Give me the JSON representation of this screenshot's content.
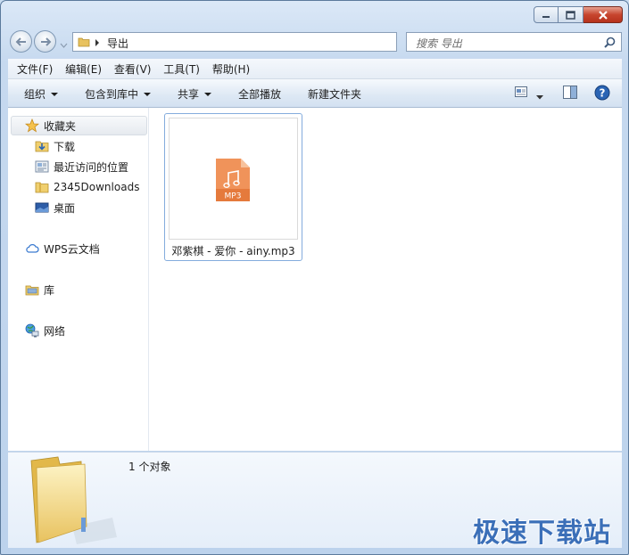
{
  "window": {
    "controls": {
      "minimize": "minimize",
      "maximize": "maximize",
      "close": "close"
    }
  },
  "navbar": {
    "address_path": "导出",
    "search_placeholder": "搜索 导出"
  },
  "menu": {
    "items": [
      "文件(F)",
      "编辑(E)",
      "查看(V)",
      "工具(T)",
      "帮助(H)"
    ]
  },
  "toolbar": {
    "organize": "组织",
    "include_in_library": "包含到库中",
    "share": "共享",
    "play_all": "全部播放",
    "new_folder": "新建文件夹"
  },
  "sidebar": {
    "favorites": "收藏夹",
    "favorites_items": [
      "下载",
      "最近访问的位置",
      "2345Downloads",
      "桌面"
    ],
    "wps_cloud": "WPS云文档",
    "libraries": "库",
    "network": "网络"
  },
  "file": {
    "name": "邓紫棋 - 爱你 - ainy.mp3",
    "badge": "MP3"
  },
  "details": {
    "count": "1 个对象"
  },
  "watermark": "极速下载站",
  "colors": {
    "mp3_orange": "#f0935a",
    "accent_blue": "#2a64b4"
  }
}
